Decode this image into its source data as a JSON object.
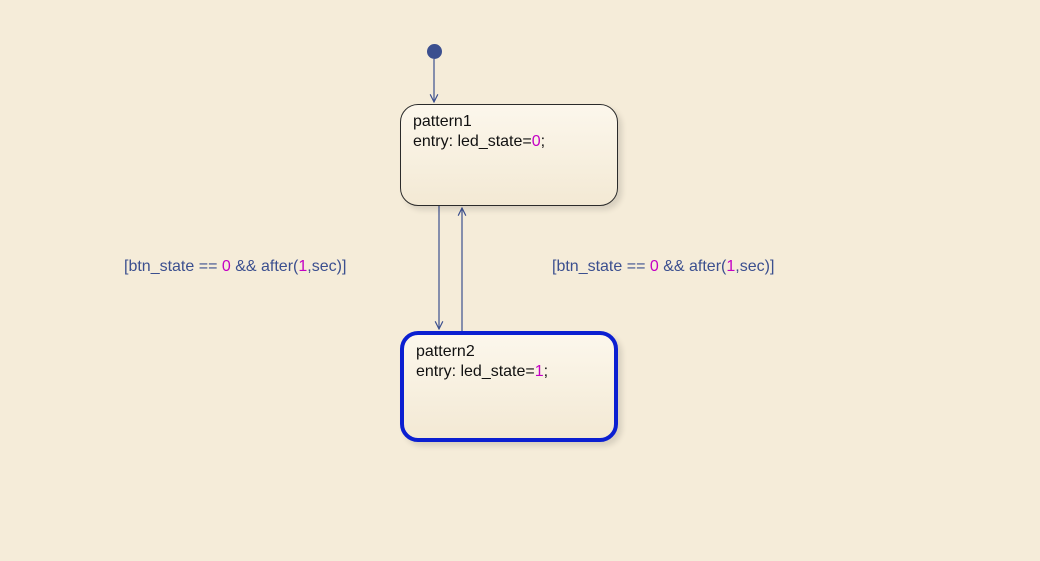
{
  "states": {
    "pattern1": {
      "name": "pattern1",
      "entry_prefix": "entry: led_state=",
      "entry_value": "0",
      "entry_suffix": ";"
    },
    "pattern2": {
      "name": "pattern2",
      "entry_prefix": "entry: led_state=",
      "entry_value": "1",
      "entry_suffix": ";"
    }
  },
  "guards": {
    "left": {
      "open": "[btn_state == ",
      "zero": "0",
      "and": " && ",
      "after": "after",
      "lparen": "(",
      "one": "1",
      "comma": ",",
      "sec": "sec",
      "close": ")]"
    },
    "right": {
      "open": "[btn_state == ",
      "zero": "0",
      "and": " && ",
      "after": "after",
      "lparen": "(",
      "one": "1",
      "comma": ",",
      "sec": "sec",
      "close": ")]"
    }
  }
}
